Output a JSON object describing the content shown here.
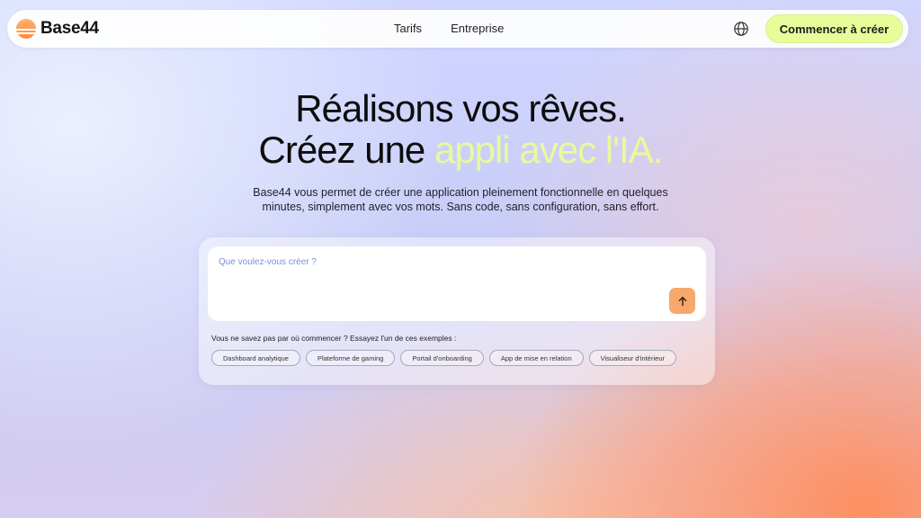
{
  "nav": {
    "logo_text": "Base44",
    "links": [
      "Tarifs",
      "Entreprise"
    ],
    "cta_label": "Commencer à créer",
    "brand_color": "#ff8a3d",
    "cta_color": "#e9fc9b"
  },
  "hero": {
    "line1": "Réalisons vos rêves.",
    "line2_prefix": "Créez une ",
    "line2_highlight": "appli avec l'IA.",
    "subtitle": "Base44 vous permet de créer une application pleinement fonctionnelle en quelques minutes, simplement avec vos mots. Sans code, sans configuration, sans effort.",
    "highlight_color": "#eaf99b"
  },
  "prompt": {
    "placeholder": "Que voulez-vous créer ?",
    "value": "",
    "send_icon": "arrow-up-icon",
    "send_color": "#f7a86c"
  },
  "examples": {
    "hint": "Vous ne savez pas par où commencer ? Essayez l'un de ces exemples :",
    "chips": [
      "Dashboard analytique",
      "Plateforme de gaming",
      "Portail d'onboarding",
      "App de mise en relation",
      "Visualiseur d'intérieur"
    ]
  },
  "icons": {
    "language": "globe-icon"
  }
}
